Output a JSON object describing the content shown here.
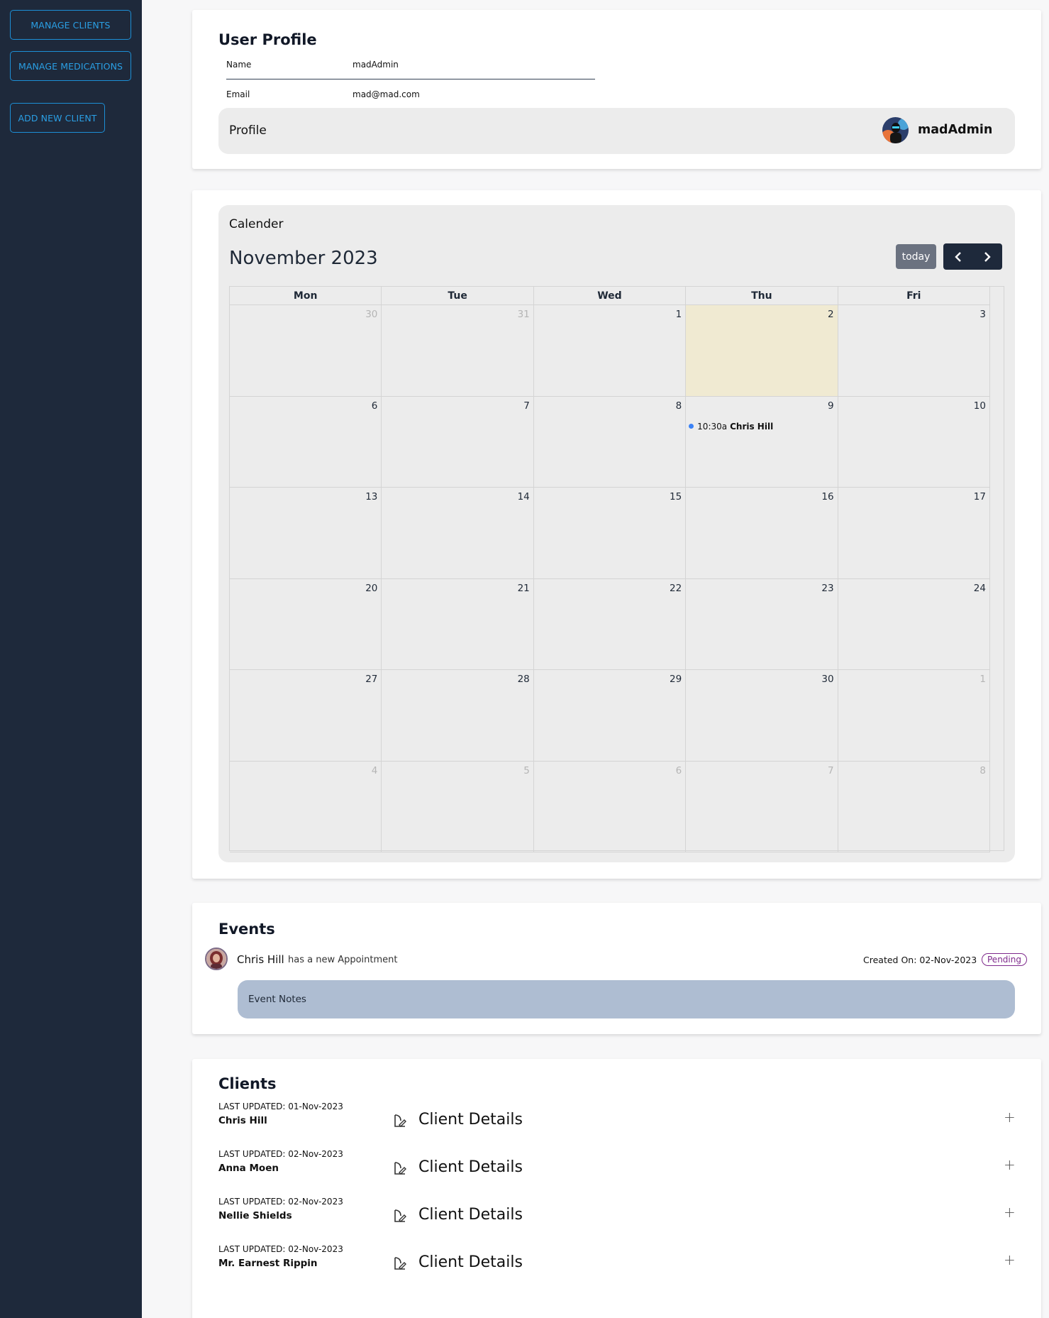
{
  "sidebar": {
    "buttons": [
      {
        "label": "MANAGE CLIENTS"
      },
      {
        "label": "MANAGE MEDICATIONS"
      },
      {
        "label": "ADD NEW CLIENT"
      }
    ]
  },
  "profile": {
    "title": "User Profile",
    "name_label": "Name",
    "name_value": "madAdmin",
    "email_label": "Email",
    "email_value": "mad@mad.com",
    "bar_title": "Profile",
    "username": "madAdmin"
  },
  "calendar": {
    "label": "Calender",
    "month": "November 2023",
    "today_label": "today",
    "prev_icon": "chevron-left-icon",
    "next_icon": "chevron-right-icon",
    "weekdays": [
      "Mon",
      "Tue",
      "Wed",
      "Thu",
      "Fri"
    ],
    "weeks": [
      [
        {
          "n": "30",
          "other": true
        },
        {
          "n": "31",
          "other": true
        },
        {
          "n": "1"
        },
        {
          "n": "2",
          "today": true
        },
        {
          "n": "3"
        }
      ],
      [
        {
          "n": "6"
        },
        {
          "n": "7"
        },
        {
          "n": "8"
        },
        {
          "n": "9",
          "event": {
            "time": "10:30a",
            "title": "Chris Hill"
          }
        },
        {
          "n": "10"
        }
      ],
      [
        {
          "n": "13"
        },
        {
          "n": "14"
        },
        {
          "n": "15"
        },
        {
          "n": "16"
        },
        {
          "n": "17"
        }
      ],
      [
        {
          "n": "20"
        },
        {
          "n": "21"
        },
        {
          "n": "22"
        },
        {
          "n": "23"
        },
        {
          "n": "24"
        }
      ],
      [
        {
          "n": "27"
        },
        {
          "n": "28"
        },
        {
          "n": "29"
        },
        {
          "n": "30"
        },
        {
          "n": "1",
          "other": true
        }
      ],
      [
        {
          "n": "4",
          "other": true
        },
        {
          "n": "5",
          "other": true
        },
        {
          "n": "6",
          "other": true
        },
        {
          "n": "7",
          "other": true
        },
        {
          "n": "8",
          "other": true
        }
      ]
    ],
    "today_color": "#f0ead2",
    "event_dot_color": "#3b82f6"
  },
  "events": {
    "title": "Events",
    "items": [
      {
        "name": "Chris Hill",
        "text": "has a new Appointment",
        "created": "Created On: 02-Nov-2023",
        "status": "Pending",
        "notes": "Event Notes"
      }
    ]
  },
  "clients": {
    "title": "Clients",
    "items": [
      {
        "updated": "LAST UPDATED: 01-Nov-2023",
        "name": "Chris Hill",
        "details": "Client Details"
      },
      {
        "updated": "LAST UPDATED: 02-Nov-2023",
        "name": "Anna Moen",
        "details": "Client Details"
      },
      {
        "updated": "LAST UPDATED: 02-Nov-2023",
        "name": "Nellie Shields",
        "details": "Client Details"
      },
      {
        "updated": "LAST UPDATED: 02-Nov-2023",
        "name": "Mr. Earnest Rippin",
        "details": "Client Details"
      }
    ],
    "expand_symbol": "+"
  }
}
